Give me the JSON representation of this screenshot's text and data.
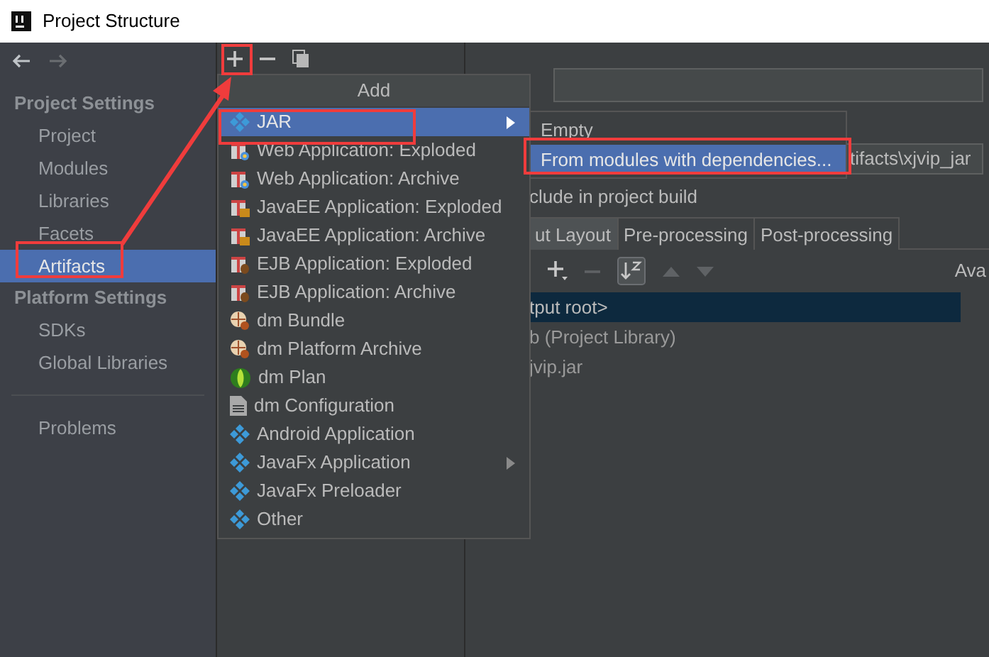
{
  "window": {
    "title": "Project Structure"
  },
  "sidebar": {
    "sections": [
      {
        "heading": "Project Settings",
        "items": [
          {
            "label": "Project",
            "selected": false
          },
          {
            "label": "Modules",
            "selected": false
          },
          {
            "label": "Libraries",
            "selected": false
          },
          {
            "label": "Facets",
            "selected": false
          },
          {
            "label": "Artifacts",
            "selected": true
          }
        ]
      },
      {
        "heading": "Platform Settings",
        "items": [
          {
            "label": "SDKs",
            "selected": false
          },
          {
            "label": "Global Libraries",
            "selected": false
          }
        ]
      }
    ],
    "footer_items": [
      {
        "label": "Problems",
        "selected": false
      }
    ]
  },
  "add_menu": {
    "title": "Add",
    "items": [
      {
        "label": "JAR",
        "kind": "diamond",
        "selected": true,
        "submenu": true
      },
      {
        "label": "Web Application: Exploded",
        "kind": "gift-web",
        "selected": false,
        "submenu": false
      },
      {
        "label": "Web Application: Archive",
        "kind": "gift-web",
        "selected": false,
        "submenu": false
      },
      {
        "label": "JavaEE Application: Exploded",
        "kind": "gift-ee",
        "selected": false,
        "submenu": false
      },
      {
        "label": "JavaEE Application: Archive",
        "kind": "gift-ee",
        "selected": false,
        "submenu": false
      },
      {
        "label": "EJB Application: Exploded",
        "kind": "gift-bean",
        "selected": false,
        "submenu": false
      },
      {
        "label": "EJB Application: Archive",
        "kind": "gift-bean",
        "selected": false,
        "submenu": false
      },
      {
        "label": "dm Bundle",
        "kind": "bundle",
        "selected": false,
        "submenu": false
      },
      {
        "label": "dm Platform Archive",
        "kind": "bundle",
        "selected": false,
        "submenu": false
      },
      {
        "label": "dm Plan",
        "kind": "globe",
        "selected": false,
        "submenu": false
      },
      {
        "label": "dm Configuration",
        "kind": "file",
        "selected": false,
        "submenu": false
      },
      {
        "label": "Android Application",
        "kind": "diamond",
        "selected": false,
        "submenu": false
      },
      {
        "label": "JavaFx Application",
        "kind": "diamond",
        "selected": false,
        "submenu": true
      },
      {
        "label": "JavaFx Preloader",
        "kind": "diamond",
        "selected": false,
        "submenu": false
      },
      {
        "label": "Other",
        "kind": "diamond",
        "selected": false,
        "submenu": false
      }
    ]
  },
  "submenu": {
    "items": [
      {
        "label": "Empty",
        "selected": false
      },
      {
        "label": "From modules with dependencies...",
        "selected": true
      }
    ]
  },
  "details": {
    "output_path": "tifacts\\xjvip_jar",
    "include_label": "clude in project build",
    "tabs": [
      {
        "label": "ut Layout",
        "selected": true
      },
      {
        "label": "Pre-processing",
        "selected": false
      },
      {
        "label": "Post-processing",
        "selected": false
      }
    ],
    "available_label": "Ava",
    "tree": [
      {
        "label": "tput root>",
        "selected": true
      },
      {
        "label": "b (Project Library)",
        "selected": false
      },
      {
        "label": "jvip.jar",
        "selected": false
      }
    ]
  }
}
